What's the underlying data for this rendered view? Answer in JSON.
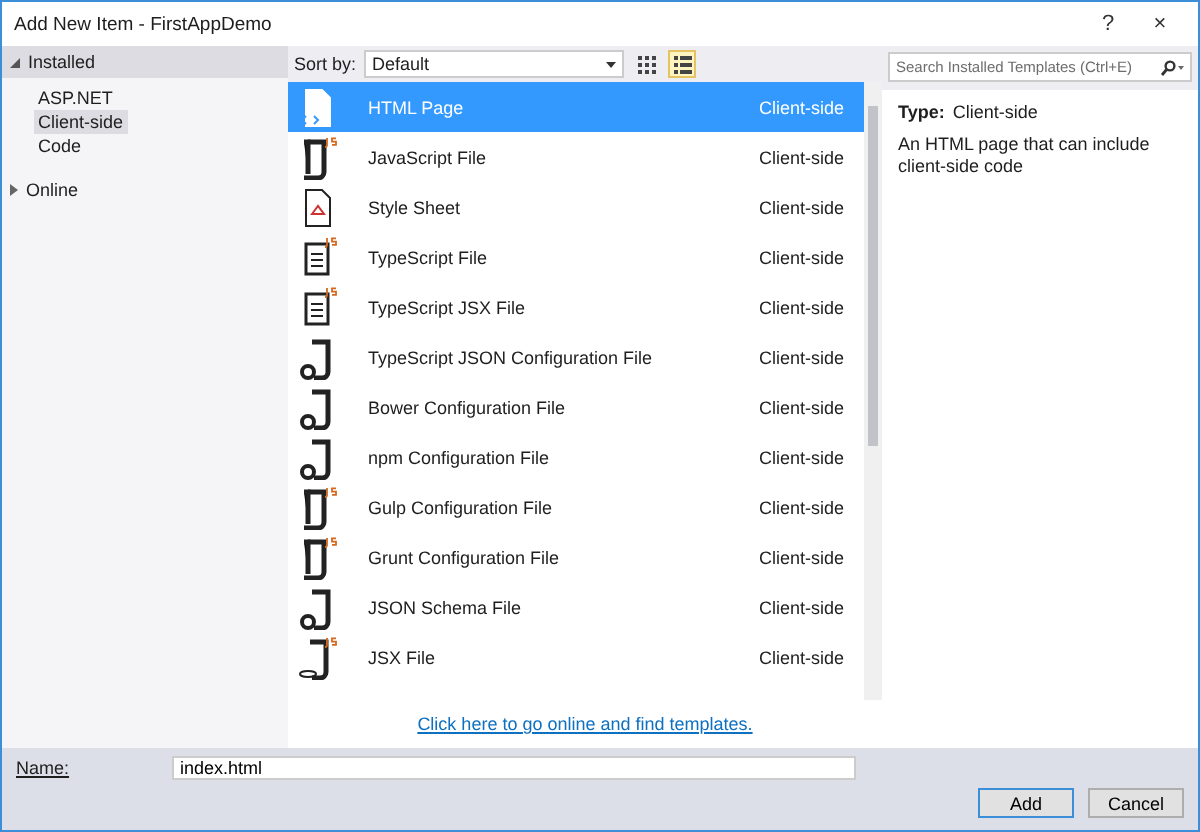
{
  "window": {
    "title": "Add New Item - FirstAppDemo",
    "help": "?",
    "close": "×"
  },
  "sidebar": {
    "items": [
      {
        "label": "Installed",
        "expanded": true,
        "children": [
          {
            "label": "ASP.NET",
            "selected": false
          },
          {
            "label": "Client-side",
            "selected": true
          },
          {
            "label": "Code",
            "selected": false
          }
        ]
      },
      {
        "label": "Online",
        "expanded": false
      }
    ]
  },
  "toolbar": {
    "sort_label": "Sort by:",
    "sort_value": "Default",
    "view_modes": [
      {
        "kind": "grid",
        "selected": false
      },
      {
        "kind": "list",
        "selected": true
      }
    ]
  },
  "templates": [
    {
      "kind": "html",
      "name": "HTML Page",
      "category": "Client-side",
      "selected": true
    },
    {
      "kind": "js",
      "name": "JavaScript File",
      "category": "Client-side",
      "selected": false
    },
    {
      "kind": "css",
      "name": "Style Sheet",
      "category": "Client-side",
      "selected": false
    },
    {
      "kind": "ts",
      "name": "TypeScript File",
      "category": "Client-side",
      "selected": false
    },
    {
      "kind": "ts",
      "name": "TypeScript JSX File",
      "category": "Client-side",
      "selected": false
    },
    {
      "kind": "config",
      "name": "TypeScript JSON Configuration File",
      "category": "Client-side",
      "selected": false
    },
    {
      "kind": "config",
      "name": "Bower Configuration File",
      "category": "Client-side",
      "selected": false
    },
    {
      "kind": "config",
      "name": "npm Configuration File",
      "category": "Client-side",
      "selected": false
    },
    {
      "kind": "js",
      "name": "Gulp Configuration File",
      "category": "Client-side",
      "selected": false
    },
    {
      "kind": "js",
      "name": "Grunt Configuration File",
      "category": "Client-side",
      "selected": false
    },
    {
      "kind": "config",
      "name": "JSON Schema File",
      "category": "Client-side",
      "selected": false
    },
    {
      "kind": "jsx",
      "name": "JSX File",
      "category": "Client-side",
      "selected": false
    }
  ],
  "online_link": "Click here to go online and find templates.",
  "details": {
    "search": {
      "placeholder": "Search Installed Templates (Ctrl+E)"
    },
    "type_label": "Type:",
    "type_value": "Client-side",
    "description": "An HTML page that can include client-side code"
  },
  "name_field": {
    "label": "Name:",
    "value": "index.html"
  },
  "buttons": [
    "Add",
    "Cancel"
  ]
}
